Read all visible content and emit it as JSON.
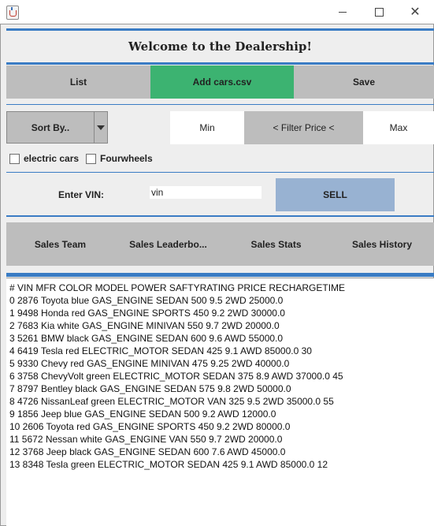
{
  "window": {
    "icon": "java-cup-icon"
  },
  "header": {
    "title": "Welcome to the Dealership!"
  },
  "toolbar": {
    "list_label": "List",
    "add_cars_label": "Add cars.csv",
    "save_label": "Save"
  },
  "filters": {
    "sort_label": "Sort By..",
    "min_label": "Min",
    "filter_price_label": "< Filter Price <",
    "max_label": "Max",
    "electric_label": "electric cars",
    "fourwheels_label": "Fourwheels"
  },
  "sell": {
    "vin_label": "Enter VIN:",
    "vin_value": "vin",
    "sell_label": "SELL"
  },
  "sales": {
    "team_label": "Sales Team",
    "leaderboard_label": "Sales Leaderbo...",
    "stats_label": "Sales Stats",
    "history_label": "Sales History"
  },
  "output": {
    "lines": [
      "# VIN MFR COLOR MODEL POWER SAFTYRATING PRICE RECHARGETIME",
      "0 2876 Toyota blue GAS_ENGINE SEDAN 500 9.5 2WD 25000.0",
      "1 9498 Honda red GAS_ENGINE SPORTS 450 9.2 2WD 30000.0",
      "2 7683 Kia white GAS_ENGINE MINIVAN 550 9.7 2WD 20000.0",
      "3 5261 BMW black GAS_ENGINE SEDAN 600 9.6 AWD 55000.0",
      "4 6419 Tesla red ELECTRIC_MOTOR SEDAN 425 9.1 AWD 85000.0 30",
      "5 9330 Chevy red GAS_ENGINE MINIVAN 475 9.25 2WD 40000.0",
      "6 3758 ChevyVolt green ELECTRIC_MOTOR SEDAN 375 8.9 AWD 37000.0 45",
      "7 8797 Bentley black GAS_ENGINE SEDAN 575 9.8 2WD 50000.0",
      "8 4726 NissanLeaf green ELECTRIC_MOTOR VAN 325 9.5 2WD 35000.0 55",
      "9 1856 Jeep blue GAS_ENGINE SEDAN 500 9.2 AWD 12000.0",
      "10 2606 Toyota red GAS_ENGINE SPORTS 450 9.2 2WD 80000.0",
      "11 5672 Nessan white GAS_ENGINE VAN 550 9.7 2WD 20000.0",
      "12 3768 Jeep black GAS_ENGINE SEDAN 600 7.6 AWD 45000.0",
      "13 8348 Tesla green ELECTRIC_MOTOR SEDAN 425 9.1 AWD 85000.0 12"
    ]
  },
  "colors": {
    "accent_line": "#3a7cc4",
    "add_button": "#3cb371",
    "sell_button": "#98b2d2",
    "button_gray": "#bdbdbd"
  }
}
